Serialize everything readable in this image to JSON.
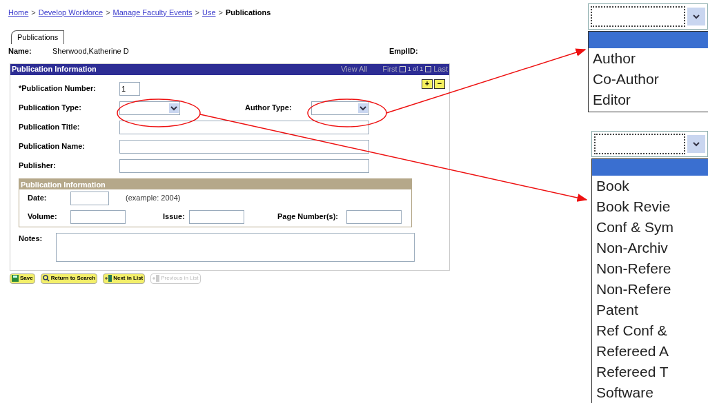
{
  "breadcrumb": [
    {
      "kind": "link",
      "label": "Home"
    },
    {
      "kind": "separator",
      "label": ">"
    },
    {
      "kind": "link",
      "label": "Develop Workforce"
    },
    {
      "kind": "separator",
      "label": ">"
    },
    {
      "kind": "link",
      "label": "Manage Faculty Events"
    },
    {
      "kind": "separator",
      "label": ">"
    },
    {
      "kind": "link",
      "label": "Use"
    },
    {
      "kind": "separator",
      "label": ">"
    },
    {
      "kind": "current",
      "label": "Publications"
    }
  ],
  "tabs": [
    {
      "label": "Publications",
      "selected": true
    }
  ],
  "header": {
    "name_label": "Name:",
    "name_value": "Sherwood,Katherine D",
    "empid_label": "EmplID:"
  },
  "panel": {
    "title": "Publication Information",
    "view_all": "View All",
    "first": "First",
    "counter": "1 of 1",
    "last": "Last",
    "add": "+",
    "remove": "−",
    "fields": [
      {
        "label": "*Publication Number:",
        "kind": "short",
        "value": "1"
      },
      {
        "label": "Publication Title:",
        "kind": "long"
      },
      {
        "label": "Publication Name:",
        "kind": "long"
      },
      {
        "label": "Publisher:",
        "kind": "long"
      }
    ],
    "type_row": {
      "publication_type_label": "Publication Type:",
      "author_type_label": "Author Type:"
    },
    "group": {
      "title": "Publication Information",
      "date_label": "Date:",
      "date_hint": "(example: 2004)",
      "volume_label": "Volume:",
      "issue_label": "Issue:",
      "pages_label": "Page Number(s):"
    },
    "notes_label": "Notes:"
  },
  "buttons": [
    {
      "label": "Save",
      "kind": "save",
      "disabled": false
    },
    {
      "label": "Return to Search",
      "kind": "search",
      "disabled": false
    },
    {
      "label": "Next in List",
      "kind": "next",
      "disabled": false
    },
    {
      "label": "Previous in List",
      "kind": "prev",
      "disabled": true
    }
  ],
  "callouts": [
    {
      "blank_selected": true,
      "options": [
        "Author",
        "Co-Author",
        "Editor"
      ]
    },
    {
      "blank_selected": true,
      "options": [
        "Book",
        "Book Revie",
        "Conf & Sym",
        "Non-Archiv",
        "Non-Refere",
        "Non-Refere",
        "Patent",
        "Ref Conf &",
        "Refereed A",
        "Refereed T",
        "Software"
      ]
    }
  ]
}
